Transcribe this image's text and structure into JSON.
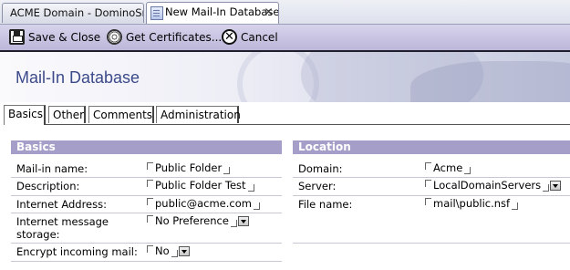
{
  "window_tabs": [
    {
      "label": "ACME Domain - DominoSrv..."
    },
    {
      "label": "New Mail-In Database"
    }
  ],
  "actions": {
    "save_close": "Save & Close",
    "get_certificates": "Get Certificates...",
    "cancel": "Cancel"
  },
  "banner": {
    "title": "Mail-In Database"
  },
  "form_tabs": [
    "Basics",
    "Other",
    "Comments",
    "Administration"
  ],
  "sections": {
    "basics": {
      "title": "Basics",
      "fields": [
        {
          "label": "Mail-in name:",
          "value": "Public Folder"
        },
        {
          "label": "Description:",
          "value": "Public Folder Test"
        },
        {
          "label": "Internet Address:",
          "value": "public@acme.com"
        },
        {
          "label": "Internet message storage:",
          "value": "No Preference"
        },
        {
          "label": "Encrypt incoming mail:",
          "value": "No"
        }
      ]
    },
    "location": {
      "title": "Location",
      "fields": [
        {
          "label": "Domain:",
          "value": "Acme"
        },
        {
          "label": "Server:",
          "value": "LocalDomainServers"
        },
        {
          "label": "File name:",
          "value": "mail\\public.nsf"
        }
      ]
    }
  },
  "colors": {
    "section_header": "#a49ec8",
    "banner_title": "#3c4a8a",
    "action_bar": "#c8c3e2"
  }
}
